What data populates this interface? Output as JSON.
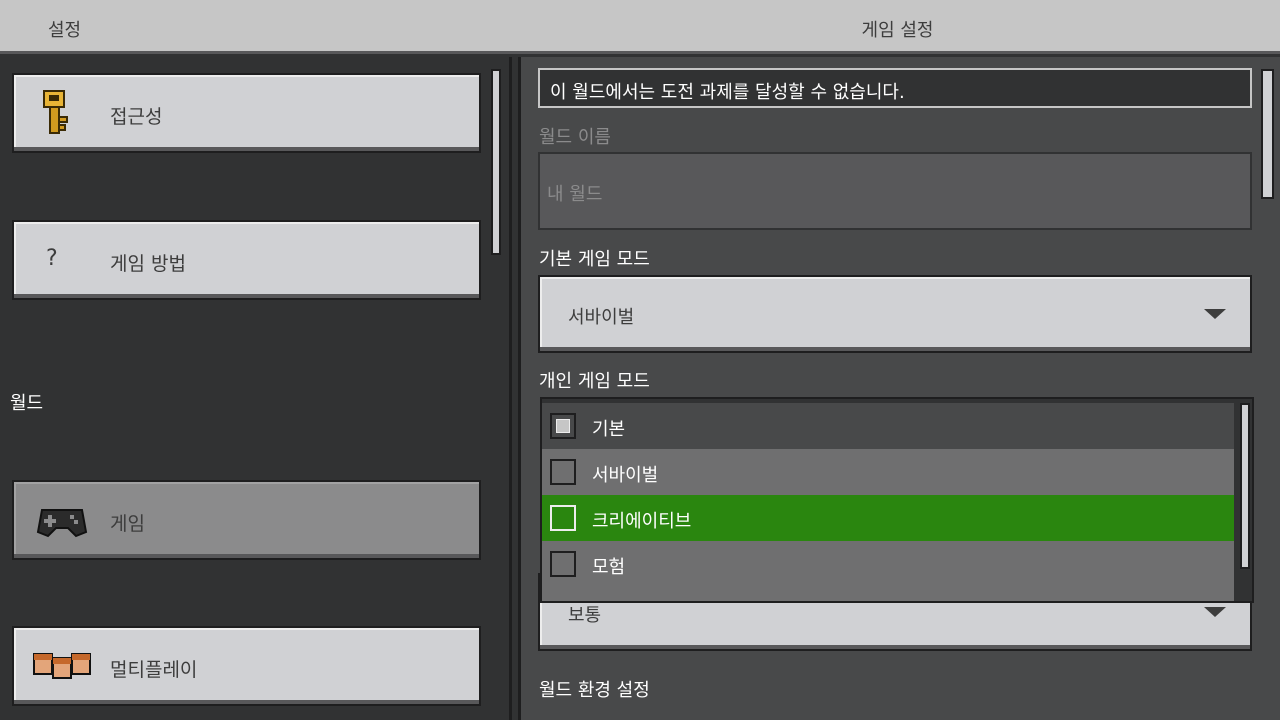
{
  "header": {
    "left_title": "설정",
    "center_title": "게임 설정"
  },
  "sidebar": {
    "buttons": [
      {
        "label": "접근성",
        "icon": "key-icon"
      },
      {
        "label": "게임 방법",
        "icon": "question-icon",
        "glyph": "?"
      },
      {
        "label": "게임",
        "icon": "gamepad-icon",
        "selected": true
      },
      {
        "label": "멀티플레이",
        "icon": "players-icon"
      }
    ],
    "section_world": "월드"
  },
  "main": {
    "banner": "이 월드에서는 도전 과제를 달성할 수 없습니다.",
    "world_name_label": "월드 이름",
    "world_name_placeholder": "내 월드",
    "default_mode_label": "기본 게임 모드",
    "default_mode_value": "서바이벌",
    "personal_mode_label": "개인 게임 모드",
    "personal_mode_options": [
      {
        "label": "기본",
        "checked": true
      },
      {
        "label": "서바이벌",
        "checked": false
      },
      {
        "label": "크리에이티브",
        "checked": false,
        "highlighted": true
      },
      {
        "label": "모험",
        "checked": false
      }
    ],
    "difficulty_value": "보통",
    "world_env_label": "월드 환경 설정"
  },
  "colors": {
    "highlight": "#2a860f",
    "hover_row": "#6f6f70",
    "panel": "#48494a"
  }
}
